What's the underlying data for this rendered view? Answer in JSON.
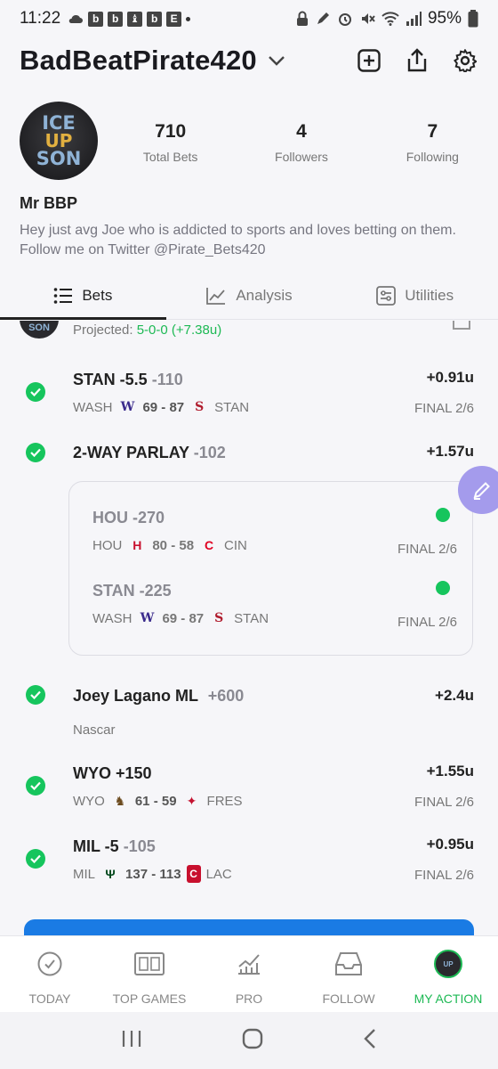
{
  "status_bar": {
    "time": "11:22",
    "left_icons": [
      "weather-cloud-icon",
      "b",
      "b",
      "chess-icon",
      "b",
      "e-app-icon"
    ],
    "battery": "95%"
  },
  "header": {
    "username": "BadBeatPirate420"
  },
  "profile": {
    "avatar_lines": [
      "ICE",
      "UP",
      "SON"
    ],
    "stats": [
      {
        "value": "710",
        "label": "Total Bets"
      },
      {
        "value": "4",
        "label": "Followers"
      },
      {
        "value": "7",
        "label": "Following"
      }
    ],
    "display_name": "Mr BBP",
    "bio": "Hey just avg Joe who is addicted to sports and loves betting on them. Follow me on Twitter @Pirate_Bets420"
  },
  "tabs": [
    {
      "label": "Bets",
      "active": true
    },
    {
      "label": "Analysis",
      "active": false
    },
    {
      "label": "Utilities",
      "active": false
    }
  ],
  "feed": {
    "projected_label": "Projected:",
    "projected_value": "5-0-0 (+7.38u)",
    "bets": [
      {
        "title": "STAN -5.5",
        "odds": "-110",
        "result": "+0.91u",
        "away": "WASH",
        "score": "69 - 87",
        "home": "STAN",
        "final": "FINAL 2/6"
      },
      {
        "title": "2-WAY PARLAY",
        "odds": "-102",
        "result": "+1.57u"
      },
      {
        "title": "Joey Lagano ML",
        "odds": "+600",
        "result": "+2.4u",
        "sub": "Nascar"
      },
      {
        "title": "WYO +150",
        "odds": "",
        "result": "+1.55u",
        "away": "WYO",
        "score": "61 - 59",
        "home": "FRES",
        "final": "FINAL 2/6"
      },
      {
        "title": "MIL -5",
        "odds": "-105",
        "result": "+0.95u",
        "away": "MIL",
        "score": "137 - 113",
        "home": "LAC",
        "final": "FINAL 2/6"
      }
    ],
    "parlay_legs": [
      {
        "title": "HOU -270",
        "away": "HOU",
        "score": "80 - 58",
        "home": "CIN",
        "final": "FINAL 2/6"
      },
      {
        "title": "STAN -225",
        "away": "WASH",
        "score": "69 - 87",
        "home": "STAN",
        "final": "FINAL 2/6"
      }
    ]
  },
  "bottom_nav": [
    {
      "label": "TODAY",
      "icon": "check-circle-icon"
    },
    {
      "label": "TOP GAMES",
      "icon": "scoreboard-icon"
    },
    {
      "label": "PRO",
      "icon": "line-chart-icon"
    },
    {
      "label": "FOLLOW",
      "icon": "inbox-icon"
    },
    {
      "label": "MY ACTION",
      "icon": "profile-avatar-icon",
      "active": true
    }
  ],
  "colors": {
    "win_green": "#16c55d",
    "accent_green": "#1db954",
    "fab_purple": "#a49bec",
    "promo_blue": "#1a7be4"
  }
}
